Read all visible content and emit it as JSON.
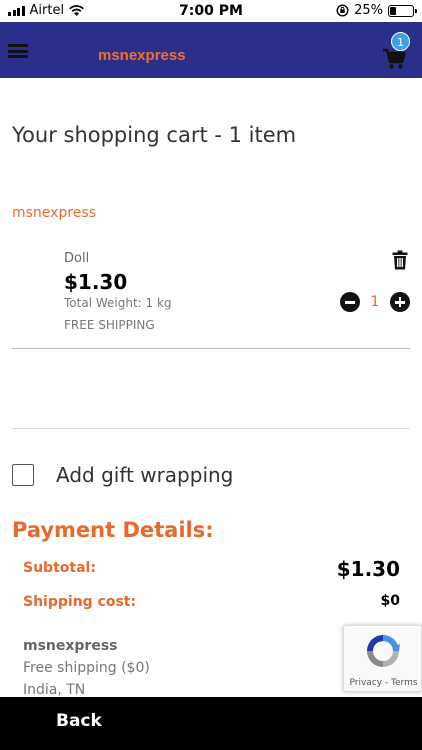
{
  "status_bar": {
    "carrier": "Airtel",
    "time": "7:00 PM",
    "battery": "25%",
    "battery_level": 0.25,
    "icons": [
      "signal-icon",
      "wifi-icon",
      "lock-rotation-icon",
      "battery-icon"
    ]
  },
  "header": {
    "brand": "msnexpress",
    "cart_count": "1",
    "icons": [
      "hamburger-icon",
      "cart-icon"
    ]
  },
  "cart": {
    "title": "Your shopping cart - 1 item",
    "seller": "msnexpress",
    "item": {
      "name": "Doll",
      "price": "$1.30",
      "weight": "Total Weight: 1 kg",
      "shipping": "FREE SHIPPING",
      "quantity": "1"
    }
  },
  "gift": {
    "label": "Add gift wrapping",
    "checked": false
  },
  "payment": {
    "title": "Payment Details:",
    "subtotal_label": "Subtotal:",
    "subtotal_value": "$1.30",
    "shipping_label": "Shipping cost:",
    "shipping_value": "$0",
    "shipper_name": "msnexpress",
    "shipper_note": "Free shipping ($0)",
    "shipper_location": "India, TN"
  },
  "recaptcha": {
    "links": "Privacy - Terms"
  },
  "footer": {
    "back_label": "Back"
  },
  "colors": {
    "header_bg": "#2c2f8a",
    "accent": "#e66a2c",
    "badge": "#3aa0e8"
  }
}
